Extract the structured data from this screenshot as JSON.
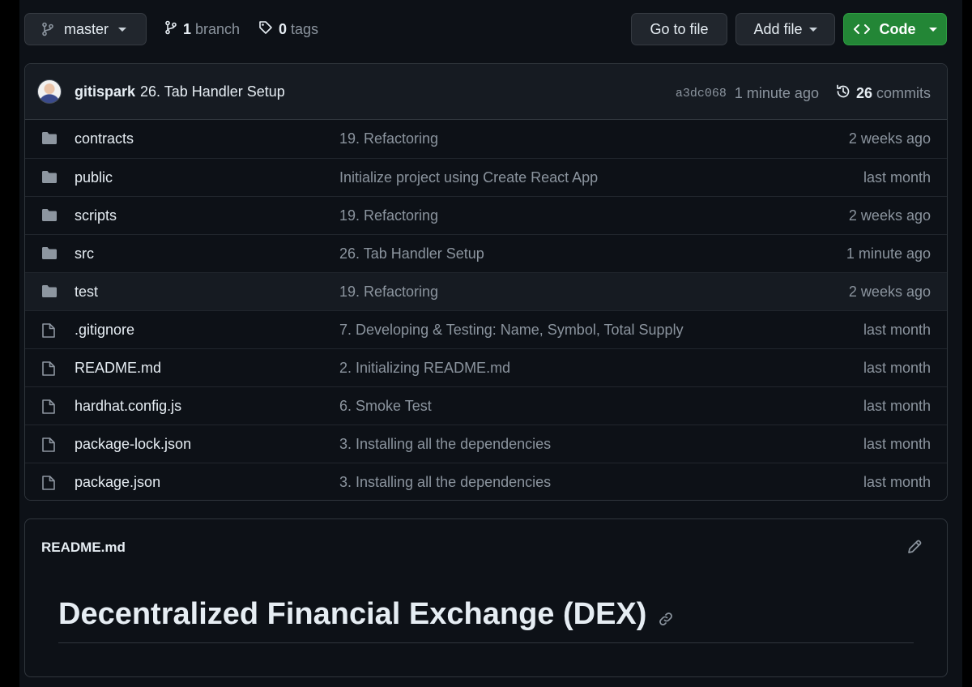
{
  "toolbar": {
    "branch": {
      "icon": "git-branch-icon",
      "label": "master"
    },
    "branches": {
      "icon": "git-branch-icon",
      "count": "1",
      "label": "branch"
    },
    "tags": {
      "icon": "tag-icon",
      "count": "0",
      "label": "tags"
    },
    "go_to_file_label": "Go to file",
    "add_file_label": "Add file",
    "code_label": "Code",
    "code_color": "#238636"
  },
  "latest_commit": {
    "author": "gitispark",
    "message": "26. Tab Handler Setup",
    "sha": "a3dc068",
    "time": "1 minute ago",
    "commit_count": "26",
    "commits_label": "commits"
  },
  "files": [
    {
      "type": "folder",
      "name": "contracts",
      "message": "19. Refactoring",
      "age": "2 weeks ago"
    },
    {
      "type": "folder",
      "name": "public",
      "message": "Initialize project using Create React App",
      "age": "last month"
    },
    {
      "type": "folder",
      "name": "scripts",
      "message": "19. Refactoring",
      "age": "2 weeks ago"
    },
    {
      "type": "folder",
      "name": "src",
      "message": "26. Tab Handler Setup",
      "age": "1 minute ago"
    },
    {
      "type": "folder",
      "name": "test",
      "message": "19. Refactoring",
      "age": "2 weeks ago"
    },
    {
      "type": "file",
      "name": ".gitignore",
      "message": "7. Developing & Testing: Name, Symbol, Total Supply",
      "age": "last month"
    },
    {
      "type": "file",
      "name": "README.md",
      "message": "2. Initializing README.md",
      "age": "last month"
    },
    {
      "type": "file",
      "name": "hardhat.config.js",
      "message": "6. Smoke Test",
      "age": "last month"
    },
    {
      "type": "file",
      "name": "package-lock.json",
      "message": "3. Installing all the dependencies",
      "age": "last month"
    },
    {
      "type": "file",
      "name": "package.json",
      "message": "3. Installing all the dependencies",
      "age": "last month"
    }
  ],
  "readme": {
    "filename": "README.md",
    "heading": "Decentralized Financial Exchange (DEX)"
  }
}
